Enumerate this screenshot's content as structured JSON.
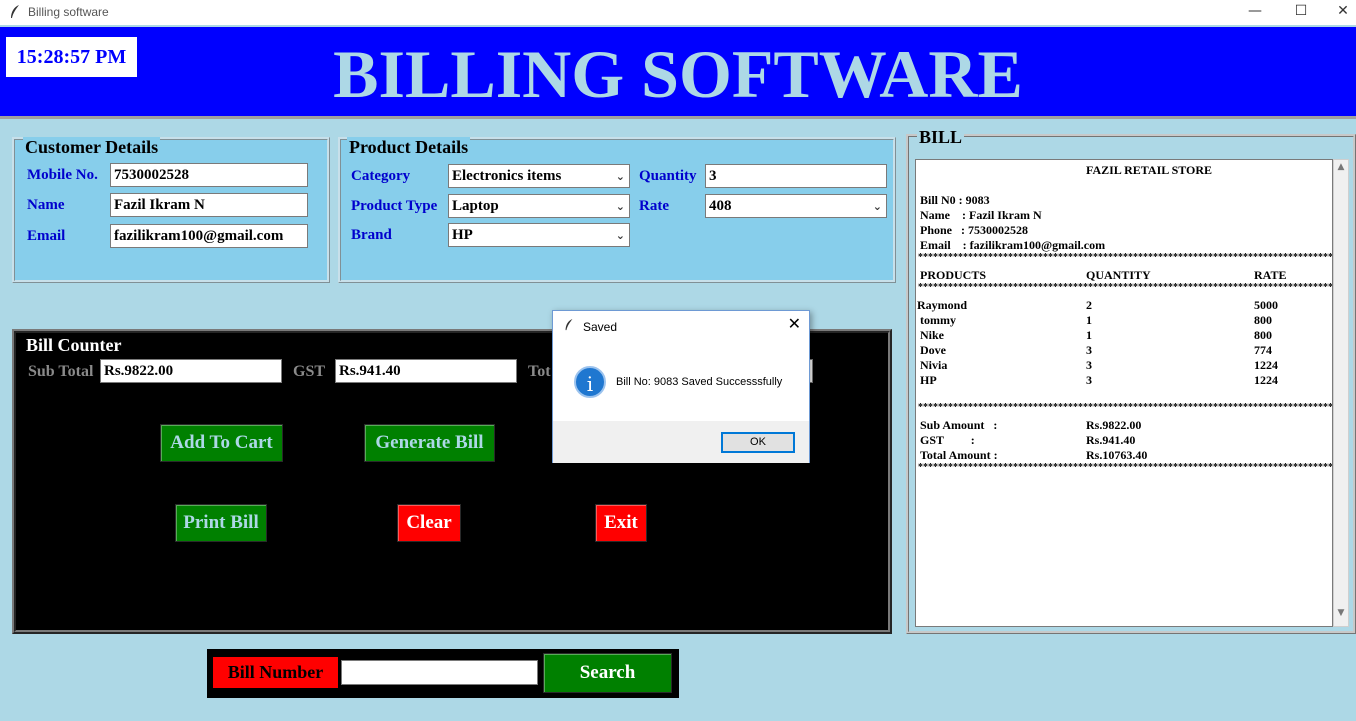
{
  "window": {
    "title": "Billing software",
    "minimize": "—",
    "maximize": "☐",
    "close": "✕"
  },
  "header": {
    "clock": "15:28:57 PM",
    "title": "BILLING SOFTWARE"
  },
  "customer": {
    "legend": "Customer Details",
    "mobile_label": "Mobile No.",
    "mobile_value": "7530002528",
    "name_label": "Name",
    "name_value": "Fazil Ikram N",
    "email_label": "Email",
    "email_value": "fazilikram100@gmail.com"
  },
  "product": {
    "legend": "Product Details",
    "category_label": "Category",
    "category_value": "Electronics items",
    "type_label": "Product Type",
    "type_value": "Laptop",
    "brand_label": "Brand",
    "brand_value": "HP",
    "quantity_label": "Quantity",
    "quantity_value": "3",
    "rate_label": "Rate",
    "rate_value": "408"
  },
  "counter": {
    "legend": "Bill Counter",
    "subtotal_label": "Sub Total",
    "subtotal_value": "Rs.9822.00",
    "gst_label": "GST",
    "gst_value": "Rs.941.40",
    "total_label": "Tot",
    "add_to_cart": "Add To Cart",
    "generate_bill": "Generate Bill",
    "print_bill": "Print Bill",
    "clear": "Clear",
    "exit": "Exit"
  },
  "bill": {
    "legend": "BILL",
    "store": "FAZIL RETAIL STORE",
    "bill_no": "Bill N0 : 9083",
    "name": "Name    : Fazil Ikram N",
    "phone": "Phone   : 7530002528",
    "email": "Email    : fazilikram100@gmail.com",
    "stars": "***************************************************************************************",
    "col_products": "PRODUCTS",
    "col_quantity": "QUANTITY",
    "col_rate": "RATE",
    "items": [
      {
        "product": "Raymond",
        "quantity": "2",
        "rate": "5000"
      },
      {
        "product": " tommy",
        "quantity": "1",
        "rate": "800"
      },
      {
        "product": " Nike",
        "quantity": "1",
        "rate": "800"
      },
      {
        "product": " Dove",
        "quantity": "3",
        "rate": "774"
      },
      {
        "product": " Nivia",
        "quantity": "3",
        "rate": "1224"
      },
      {
        "product": " HP",
        "quantity": "3",
        "rate": "1224"
      }
    ],
    "sub_label": "Sub Amount   :",
    "sub_value": "Rs.9822.00",
    "gst_label": "GST         :",
    "gst_value": "Rs.941.40",
    "total_label": "Total Amount :",
    "total_value": "Rs.10763.40"
  },
  "search": {
    "label": "Bill Number",
    "value": "",
    "button": "Search"
  },
  "dialog": {
    "title": "Saved",
    "message": "Bill No: 9083 Saved Successsfully",
    "ok": "OK",
    "close": "✕",
    "info_glyph": "i"
  }
}
